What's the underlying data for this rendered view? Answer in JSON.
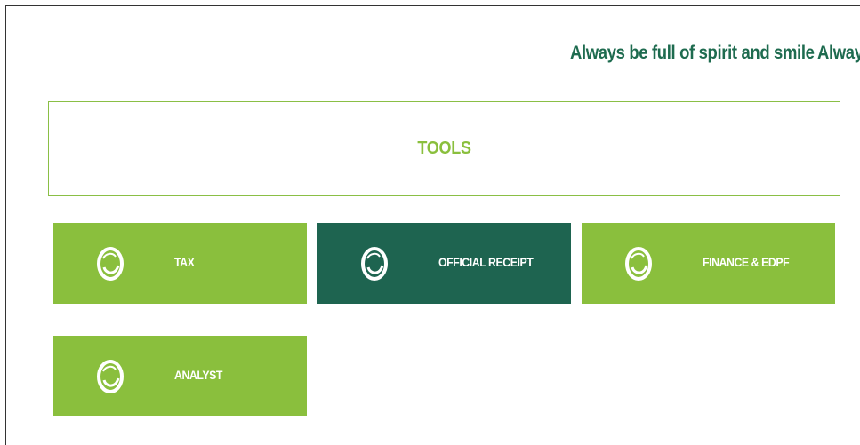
{
  "ticker": {
    "message": "Always be full of spirit and smile",
    "message_repeat": "Always"
  },
  "tools": {
    "title": "TOOLS"
  },
  "tiles": [
    {
      "label": "TAX",
      "icon": "circular-logo-icon",
      "active": false
    },
    {
      "label": "OFFICIAL RECEIPT",
      "icon": "circular-logo-icon",
      "active": true
    },
    {
      "label": "FINANCE & EDPF",
      "icon": "circular-logo-icon",
      "active": false
    },
    {
      "label": "ANALYST",
      "icon": "circular-logo-icon",
      "active": false
    }
  ],
  "colors": {
    "tile_green": "#8abf3d",
    "tile_active": "#1e6450",
    "ticker_text": "#1e6b4f",
    "tools_text": "#8abf3d"
  }
}
